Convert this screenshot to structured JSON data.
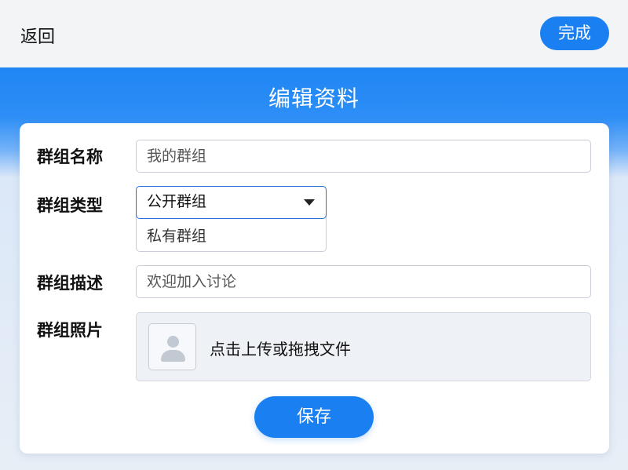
{
  "header": {
    "back_label": "返回",
    "done_label": "完成"
  },
  "page": {
    "title": "编辑资料"
  },
  "form": {
    "name": {
      "label": "群组名称",
      "value": "我的群组"
    },
    "type": {
      "label": "群组类型",
      "selected": "公开群组",
      "options": [
        "公开群组",
        "私有群组"
      ]
    },
    "description": {
      "label": "群组描述",
      "value": "欢迎加入讨论"
    },
    "photo": {
      "label": "群组照片",
      "upload_text": "点击上传或拖拽文件"
    },
    "save_label": "保存"
  },
  "colors": {
    "accent": "#1a7ff0",
    "banner": "#2d8ef6",
    "focus_border": "#2d6fd8"
  },
  "icons": {
    "caret": "caret-down-icon",
    "avatar": "user-placeholder-icon"
  }
}
